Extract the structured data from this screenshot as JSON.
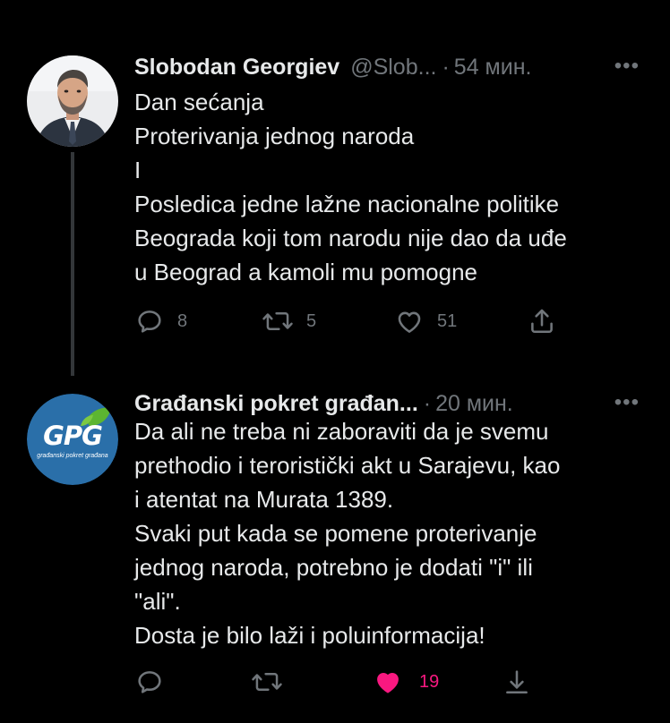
{
  "colors": {
    "background": "#000000",
    "text_primary": "#e7e9ea",
    "text_secondary": "#71767b",
    "like_active": "#f91880",
    "thread_line": "#333639"
  },
  "tweets": [
    {
      "author_name": "Slobodan Georgiev",
      "author_handle": "@Slob...",
      "separator": "·",
      "time": "54 мин.",
      "more_icon": "more-horizontal-icon",
      "more_label": "•••",
      "lines": [
        "Dan sećanja",
        "Proterivanja jednog naroda",
        "I",
        "Posledica jedne lažne nacionalne politike",
        "Beograda koji tom narodu nije dao da uđe",
        "u Beograd a kamoli mu pomogne"
      ],
      "replies": "8",
      "retweets": "5",
      "likes": "51",
      "liked": false
    },
    {
      "author_name": "Građanski pokret građan...",
      "author_handle": "",
      "separator": "·",
      "time": "20 мин.",
      "more_icon": "more-horizontal-icon",
      "more_label": "•••",
      "avatar_logo_text": "GPG",
      "avatar_logo_subtext": "građanski pokret građana",
      "lines": [
        "Da ali ne treba ni zaboraviti da je svemu",
        "prethodio i teroristički akt u Sarajevu, kao",
        "i atentat na Murata 1389.",
        "Svaki put kada se pomene proterivanje",
        "jednog naroda, potrebno je dodati \"i\" ili",
        "\"ali\".",
        "Dosta je bilo laži i poluinformacija!"
      ],
      "replies": "",
      "retweets": "",
      "likes": "19",
      "liked": true
    }
  ]
}
